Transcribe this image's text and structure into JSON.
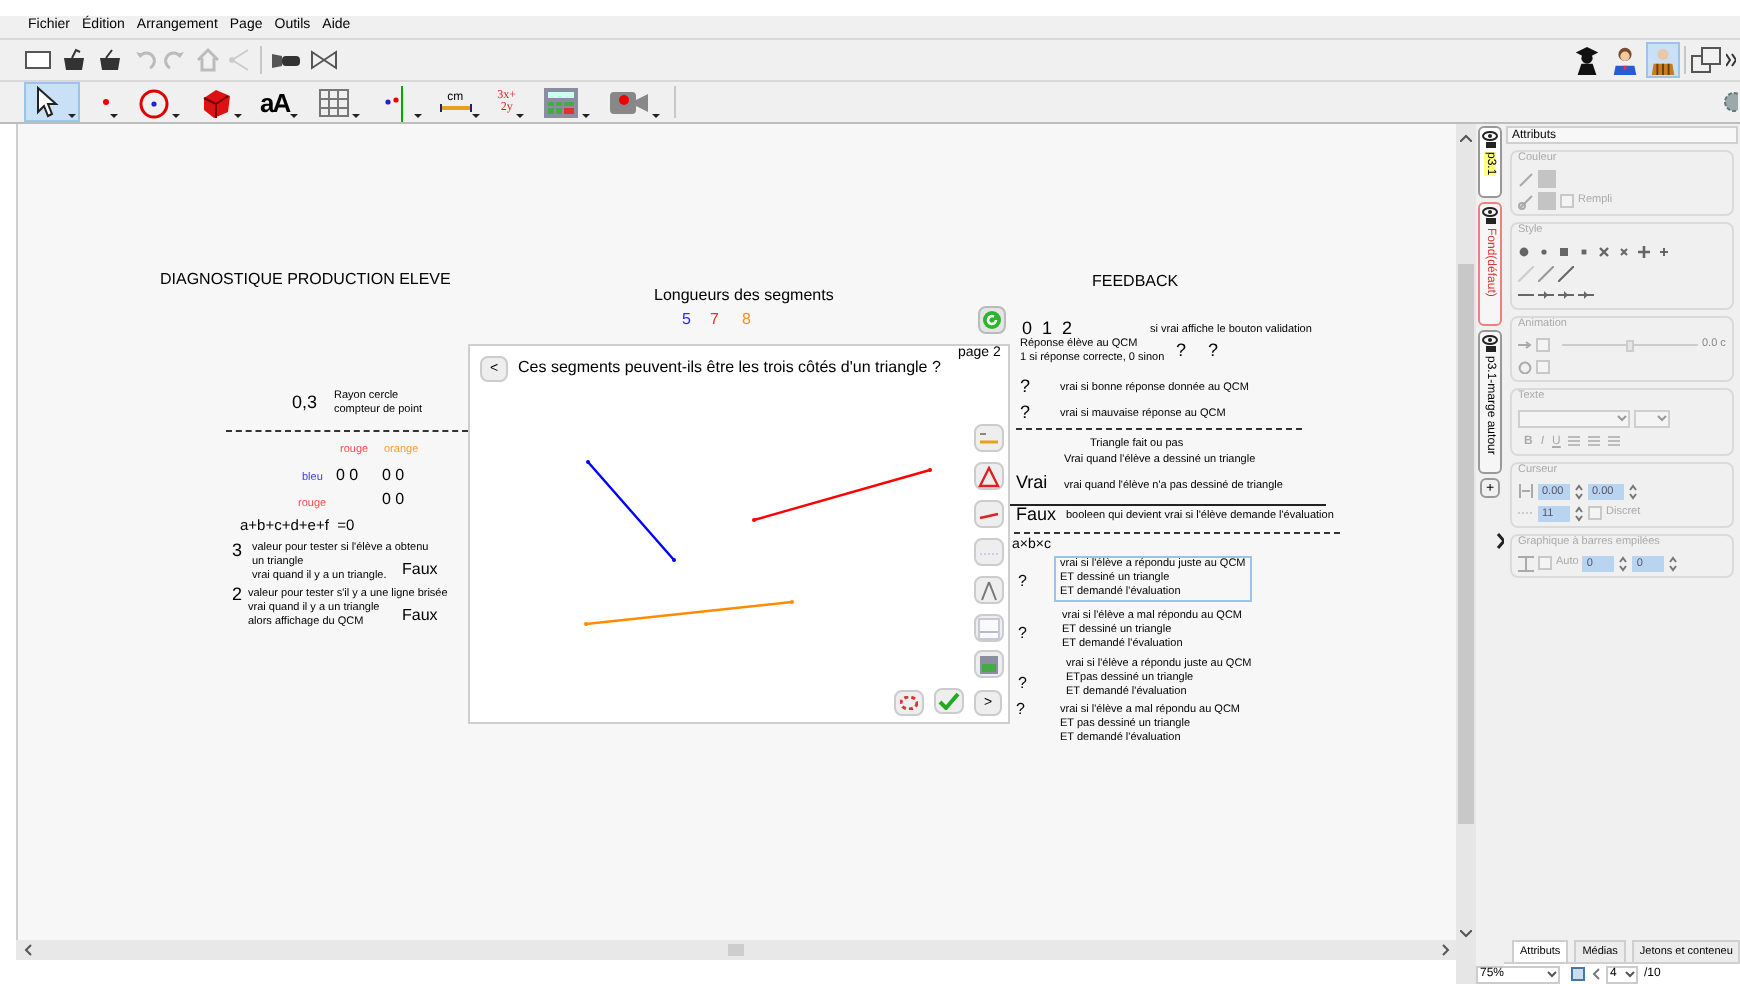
{
  "menu": [
    "Fichier",
    "Édition",
    "Arrangement",
    "Page",
    "Outils",
    "Aide"
  ],
  "modes": [
    {
      "kind": "student",
      "selected": false
    },
    {
      "kind": "teacher",
      "selected": false
    },
    {
      "kind": "author",
      "selected": true
    }
  ],
  "tools": [
    {
      "kind": "pointer",
      "selected": true
    },
    {
      "kind": "point",
      "selected": false
    },
    {
      "kind": "circle",
      "selected": false
    },
    {
      "kind": "solid",
      "selected": false
    },
    {
      "kind": "text",
      "label": "aA",
      "selected": false
    },
    {
      "kind": "grid",
      "selected": false
    },
    {
      "kind": "line",
      "selected": false
    },
    {
      "kind": "measure",
      "label": "cm",
      "selected": false
    },
    {
      "kind": "formula",
      "label": "3x+\n2y",
      "selected": false
    },
    {
      "kind": "table",
      "selected": false
    },
    {
      "kind": "camera",
      "selected": false
    }
  ],
  "diagnostic": [
    {
      "text": "DIAGNOSTIQUE PRODUCTION ELEVE"
    },
    {
      "text": "0,3"
    },
    {
      "text": "Rayon cercle\ncompteur de point"
    },
    {
      "text": "rouge",
      "color": "#ff4a4a"
    },
    {
      "text": "orange",
      "color": "#ff9933"
    },
    {
      "text": "bleu",
      "color": "#3a3aff"
    },
    {
      "text": "0 0"
    },
    {
      "text": "0 0"
    },
    {
      "text": "rouge",
      "color": "#ff4a4a"
    },
    {
      "text": "0 0"
    },
    {
      "text": "a+b+c+d+e+f  =0"
    },
    {
      "text": "3"
    },
    {
      "text": "valeur pour tester si l'élève a obtenu"
    },
    {
      "text": "un triangle"
    },
    {
      "text": "vrai quand il y a un triangle."
    },
    {
      "text": "Faux"
    },
    {
      "text": "2"
    },
    {
      "text": "valeur pour tester s'il y a une ligne brisée"
    },
    {
      "text": "vrai quand il y a un triangle"
    },
    {
      "text": "alors affichage du QCM"
    },
    {
      "text": "Faux"
    }
  ],
  "lengths": {
    "title": "Longueurs des segments",
    "values": [
      {
        "text": "5",
        "color": "#2b2bff"
      },
      {
        "text": "7",
        "color": "#ff2b2b"
      },
      {
        "text": "8",
        "color": "#ff8c1a"
      }
    ]
  },
  "dialog": {
    "question": "Ces segments peuvent-ils être les trois côtés d'un triangle ?",
    "page": "page 2",
    "back": "<",
    "next": ">",
    "segments": [
      {
        "color": "#0000ff"
      },
      {
        "color": "#ff0000"
      },
      {
        "color": "#ff8c00"
      }
    ]
  },
  "feedback": {
    "items": [
      {
        "text": "FEEDBACK"
      },
      {
        "text": "0  1  2"
      },
      {
        "text": "si vrai affiche le bouton validation"
      },
      {
        "text": "Réponse élève au QCM\n1 si réponse correcte, 0 sinon"
      },
      {
        "text": "?"
      },
      {
        "text": "?"
      },
      {
        "text": "?"
      },
      {
        "text": "vrai si bonne réponse donnée au QCM"
      },
      {
        "text": "?"
      },
      {
        "text": "vrai si mauvaise réponse au QCM"
      },
      {
        "text": "Triangle fait ou pas"
      },
      {
        "text": "Vrai quand l'élève a dessiné un triangle"
      },
      {
        "text": "Vrai"
      },
      {
        "text": "vrai quand l'élève n'a pas dessiné de triangle"
      },
      {
        "text": "Faux"
      },
      {
        "text": "booleen qui devient vrai si l'élève demande l'évaluation"
      },
      {
        "text": "a×b×c"
      }
    ],
    "conditions": [
      {
        "mark": "?",
        "text": "vrai si l'élève a répondu juste au QCM\nET dessiné un triangle\nET demandé l'évaluation",
        "selected": true
      },
      {
        "mark": "?",
        "text": "vrai si l'élève a mal répondu au QCM\nET dessiné un triangle\nET demandé l'évaluation",
        "selected": false
      },
      {
        "mark": "?",
        "text": "vrai si l'élève a répondu juste au QCM\nETpas dessiné un triangle\nET demandé l'évaluation",
        "selected": false
      },
      {
        "mark": "?",
        "text": "vrai si l'élève a mal répondu au QCM\nET pas dessiné un triangle\nET demandé l'évaluation",
        "selected": false
      }
    ]
  },
  "layers": [
    {
      "name": "p3.1",
      "kind": "normal",
      "selected": true
    },
    {
      "name": "Fond(défaut)",
      "kind": "default",
      "selected": false
    },
    {
      "name": "p3.1-marge autour",
      "kind": "normal",
      "selected": false
    }
  ],
  "layer_add": "+",
  "attributes": {
    "title": "Attributs",
    "color_section": {
      "title": "Couleur",
      "fill_label": "Rempli",
      "filled": false
    },
    "style_section": {
      "title": "Style"
    },
    "animation_section": {
      "title": "Animation",
      "value": "0.0 c",
      "level": 0.5,
      "motion_checked": false,
      "timer_checked": false
    },
    "text_section": {
      "title": "Texte",
      "format_buttons": [
        "B",
        "I",
        "U"
      ]
    },
    "cursor_section": {
      "title": "Curseur",
      "min": "0.00",
      "max": "0.00",
      "step": "11",
      "discrete_label": "Discret",
      "discrete": false
    },
    "bar_section": {
      "title": "Graphique à barres empilées",
      "auto_label": "Auto",
      "auto": false,
      "value_1": "0",
      "value_2": "0"
    }
  },
  "bottom_tabs": [
    {
      "label": "Attributs",
      "selected": true
    },
    {
      "label": "Médias",
      "selected": false
    },
    {
      "label": "Jetons et conteneu",
      "selected": false
    }
  ],
  "status": {
    "zoom": "75%",
    "page": "4",
    "page_count": "/10"
  }
}
